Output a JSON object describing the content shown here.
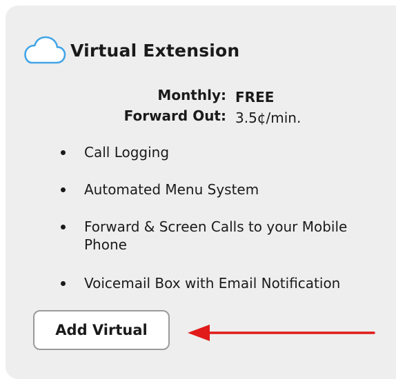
{
  "card": {
    "icon": "cloud-icon",
    "title": "Virtual Extension",
    "accent_color": "#41a4e6",
    "pricing": [
      {
        "label": "Monthly:",
        "value": "FREE",
        "value_bold": true
      },
      {
        "label": "Forward Out:",
        "value": "3.5¢/min.",
        "value_bold": false
      }
    ],
    "features": [
      {
        "text": "Call Logging"
      },
      {
        "text": "Automated Menu System"
      },
      {
        "text": "Forward & Screen Calls to your Mobile Phone"
      },
      {
        "text": "Voicemail Box with Email Notification"
      }
    ],
    "button_label": "Add Virtual"
  },
  "annotation": {
    "arrow_color": "#e11a1a",
    "arrow_icon": "left-arrow-icon"
  }
}
